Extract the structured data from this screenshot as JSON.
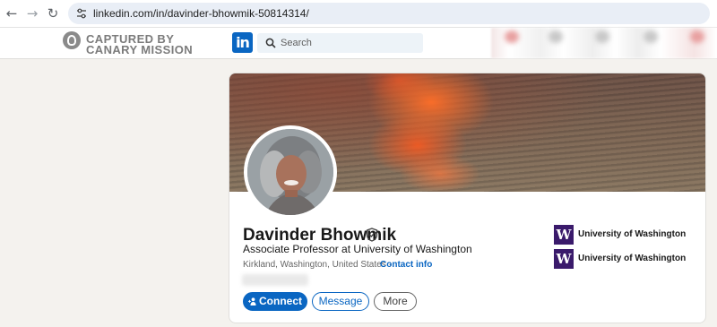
{
  "browser": {
    "back_icon": "arrow-left-icon",
    "forward_icon": "arrow-right-icon",
    "reload_icon": "reload-icon",
    "url": "linkedin.com/in/davinder-bhowmik-50814314/"
  },
  "watermark": {
    "line1": "CAPTURED BY",
    "line2": "CANARY MISSION"
  },
  "nav": {
    "logo_text": "in",
    "search_placeholder": "Search"
  },
  "profile": {
    "name": "Davinder Bhowmik",
    "headline": "Associate Professor at University of Washington",
    "location": "Kirkland, Washington, United States ·",
    "contact_label": "Contact info",
    "education": [
      {
        "logo": "W",
        "school": "University of Washington"
      },
      {
        "logo": "W",
        "school": "University of Washington"
      }
    ]
  },
  "actions": {
    "connect_label": "Connect",
    "message_label": "Message",
    "more_label": "More"
  },
  "colors": {
    "linkedin_blue": "#0a66c2",
    "uw_purple": "#3a1a6b",
    "page_bg": "#f4f2ee"
  }
}
